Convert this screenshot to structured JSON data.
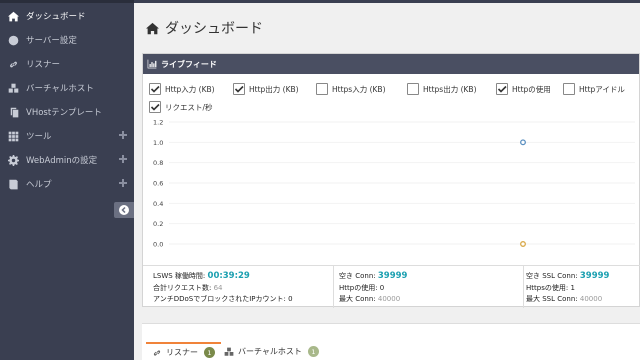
{
  "sidebar": {
    "items": [
      {
        "label": "ダッシュボード",
        "icon": "home-icon",
        "active": true,
        "expandable": false
      },
      {
        "label": "サーバー設定",
        "icon": "globe-icon",
        "active": false,
        "expandable": false
      },
      {
        "label": "リスナー",
        "icon": "link-icon",
        "active": false,
        "expandable": false
      },
      {
        "label": "バーチャルホスト",
        "icon": "cubes-icon",
        "active": false,
        "expandable": false
      },
      {
        "label": "VHostテンプレート",
        "icon": "copy-icon",
        "active": false,
        "expandable": false
      },
      {
        "label": "ツール",
        "icon": "grid-icon",
        "active": false,
        "expandable": true
      },
      {
        "label": "WebAdminの設定",
        "icon": "gear-icon",
        "active": false,
        "expandable": true
      },
      {
        "label": "ヘルプ",
        "icon": "book-icon",
        "active": false,
        "expandable": true
      }
    ]
  },
  "page": {
    "title": "ダッシュボード"
  },
  "livefeed": {
    "title": "ライブフィード",
    "checkboxes": [
      {
        "label": "Http入力 (KB)",
        "checked": true
      },
      {
        "label": "Http出力 (KB)",
        "checked": true
      },
      {
        "label": "Https入力 (KB)",
        "checked": false
      },
      {
        "label": "Https出力 (KB)",
        "checked": false
      },
      {
        "label": "Httpの使用",
        "checked": true
      },
      {
        "label": "Httpアイドル",
        "checked": false
      },
      {
        "label": "リクエスト/秒",
        "checked": true
      }
    ]
  },
  "chart_data": {
    "type": "scatter",
    "ylim": [
      0,
      1.2
    ],
    "yticks": [
      "1.2",
      "1.0",
      "0.8",
      "0.6",
      "0.4",
      "0.2",
      "0.0"
    ],
    "series": [
      {
        "color": "#5a8fc0",
        "points": [
          {
            "y": 1.0
          }
        ]
      },
      {
        "color": "#d8a848",
        "points": [
          {
            "y": 0.0
          }
        ]
      }
    ]
  },
  "stats": {
    "col1": {
      "uptime_label": "LSWS 稼働時間:",
      "uptime_value": "00:39:29",
      "total_requests_label": "合計リクエスト数:",
      "total_requests_value": "64",
      "antiddos_label": "アンチDDoSでブロックされたIPカウント:",
      "antiddos_value": "0"
    },
    "col2": {
      "free_conn_label": "空き Conn:",
      "free_conn_value": "39999",
      "http_used_label": "Httpの使用:",
      "http_used_value": "0",
      "max_conn_label": "最大 Conn:",
      "max_conn_value": "40000"
    },
    "col3": {
      "free_ssl_label": "空き SSL Conn:",
      "free_ssl_value": "39999",
      "https_used_label": "Httpsの使用:",
      "https_used_value": "1",
      "max_ssl_label": "最大 SSL Conn:",
      "max_ssl_value": "40000"
    }
  },
  "tabs": [
    {
      "label": "リスナー",
      "count": "1",
      "icon": "link-icon",
      "active": true
    },
    {
      "label": "バーチャルホスト",
      "count": "1",
      "icon": "cubes-icon",
      "active": false
    }
  ],
  "colors": {
    "accent": "#f0833a",
    "teal": "#1a9fb0",
    "sidebar": "#3a3f51",
    "panel_header": "#4a4f62"
  }
}
